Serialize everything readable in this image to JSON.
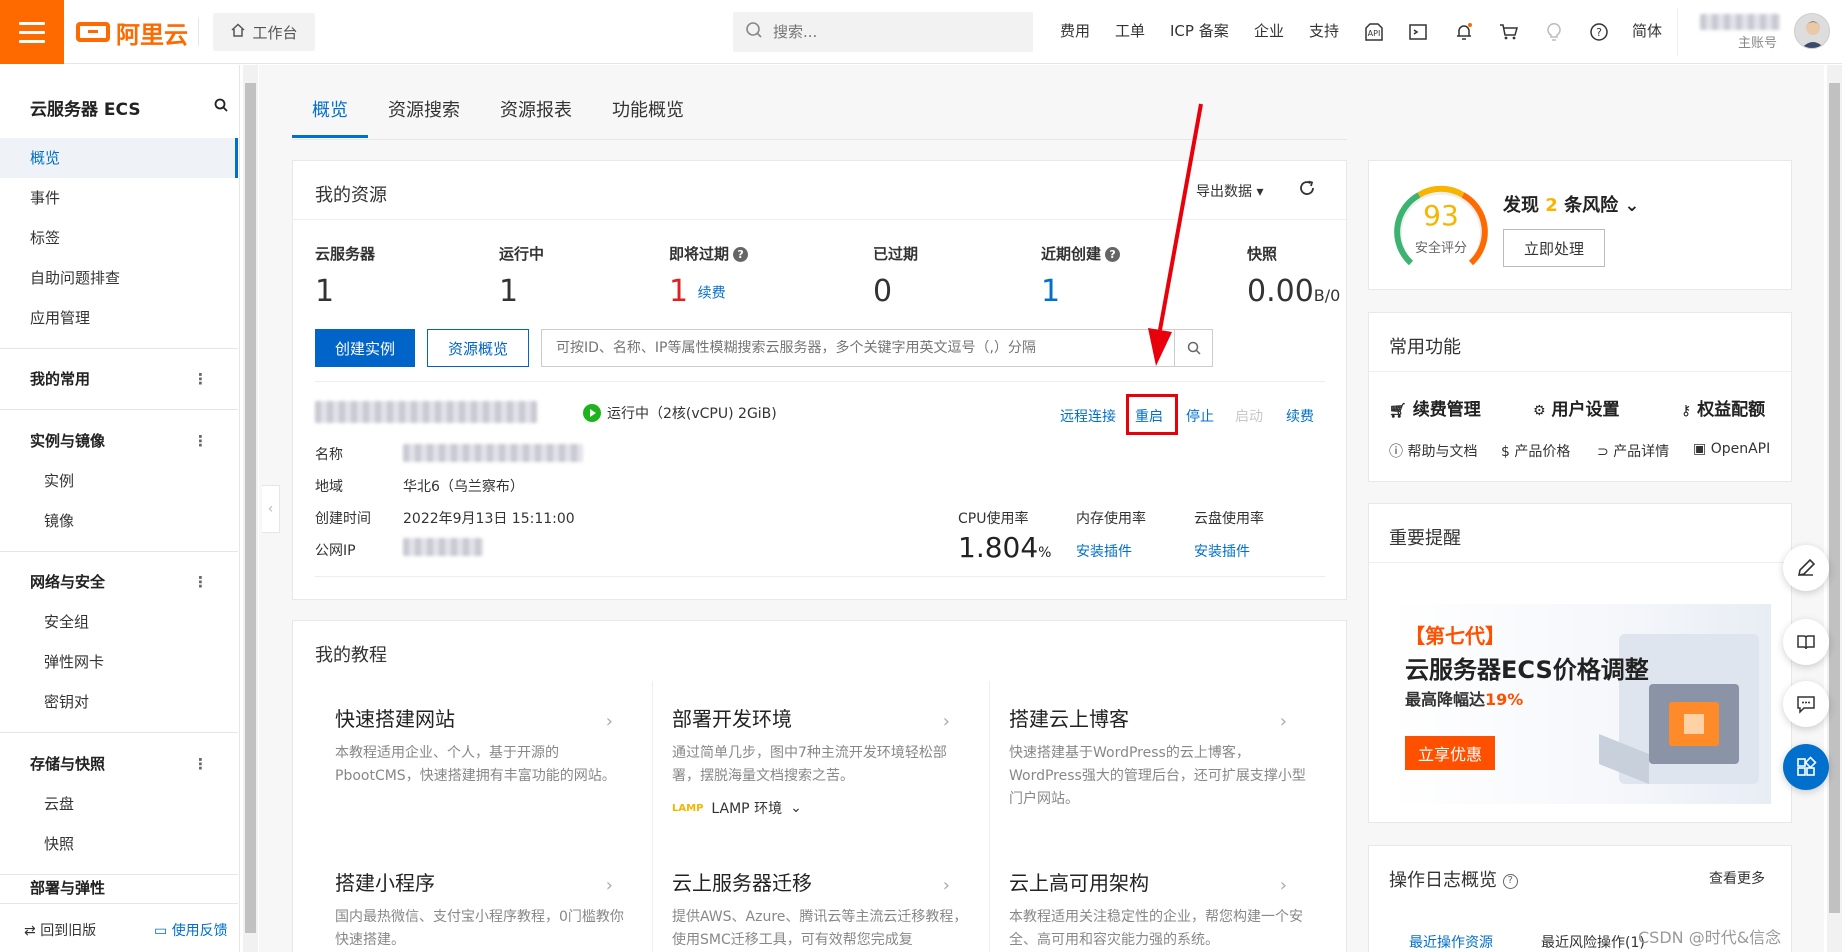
{
  "header": {
    "logo_text": "阿里云",
    "workbench_label": "工作台",
    "search_placeholder": "搜索...",
    "nav": [
      "费用",
      "工单",
      "ICP 备案",
      "企业",
      "支持"
    ],
    "lang_label": "简体",
    "account_sub": "主账号"
  },
  "sidebar": {
    "title": "云服务器 ECS",
    "items": [
      {
        "label": "概览"
      },
      {
        "label": "事件"
      },
      {
        "label": "标签"
      },
      {
        "label": "自助问题排查"
      },
      {
        "label": "应用管理"
      }
    ],
    "favorites": "我的常用",
    "groups": [
      {
        "label": "实例与镜像",
        "children": [
          "实例",
          "镜像"
        ]
      },
      {
        "label": "网络与安全",
        "children": [
          "安全组",
          "弹性网卡",
          "密钥对"
        ]
      },
      {
        "label": "存储与快照",
        "children": [
          "云盘",
          "快照"
        ]
      },
      {
        "label": "部署与弹性"
      }
    ],
    "footer_back": "回到旧版",
    "footer_feedback": "使用反馈"
  },
  "tabs": [
    "概览",
    "资源搜索",
    "资源报表",
    "功能概览"
  ],
  "resources": {
    "title": "我的资源",
    "export_label": "导出数据",
    "stats": [
      {
        "label": "云服务器",
        "value": "1"
      },
      {
        "label": "运行中",
        "value": "1"
      },
      {
        "label": "即将过期",
        "value": "1",
        "action": "续费"
      },
      {
        "label": "已过期",
        "value": "0"
      },
      {
        "label": "近期创建",
        "value": "1"
      },
      {
        "label": "快照",
        "value": "0.00",
        "unit": "B/0"
      }
    ],
    "create_button": "创建实例",
    "overview_button": "资源概览",
    "search_placeholder": "可按ID、名称、IP等属性模糊搜索云服务器，多个关键字用英文逗号（,）分隔",
    "instance": {
      "status": "运行中（2核(vCPU) 2GiB)",
      "actions": [
        "远程连接",
        "重启",
        "停止",
        "启动",
        "续费"
      ],
      "fields": [
        {
          "label": "名称",
          "value": ""
        },
        {
          "label": "地域",
          "value": "华北6（乌兰察布）"
        },
        {
          "label": "创建时间",
          "value": "2022年9月13日 15:11:00"
        },
        {
          "label": "公网IP",
          "value": ""
        }
      ],
      "metrics": [
        {
          "label": "CPU使用率",
          "value": "1.804",
          "unit": "%"
        },
        {
          "label": "内存使用率",
          "link": "安装插件"
        },
        {
          "label": "云盘使用率",
          "link": "安装插件"
        }
      ]
    }
  },
  "tutorials": {
    "title": "我的教程",
    "items": [
      {
        "title": "快速搭建网站",
        "desc": "本教程适用企业、个人，基于开源的PbootCMS，快速搭建拥有丰富功能的网站。"
      },
      {
        "title": "部署开发环境",
        "desc": "通过简单几步，图中7种主流开发环境轻松部署，摆脱海量文档搜索之苦。",
        "extra": "LAMP 环境"
      },
      {
        "title": "搭建云上博客",
        "desc": "快速搭建基于WordPress的云上博客，WordPress强大的管理后台，还可扩展支撑小型门户网站。"
      },
      {
        "title": "搭建小程序",
        "desc": "国内最热微信、支付宝小程序教程，0门槛教你快速搭建。"
      },
      {
        "title": "云上服务器迁移",
        "desc": "提供AWS、Azure、腾讯云等主流云迁移教程，使用SMC迁移工具，可有效帮您完成复"
      },
      {
        "title": "云上高可用架构",
        "desc": "本教程适用关注稳定性的企业，帮您构建一个安全、高可用和容灾能力强的系统。"
      }
    ]
  },
  "security": {
    "score": "93",
    "score_label": "安全评分",
    "risk_prefix": "发现",
    "risk_count": "2",
    "risk_suffix": "条风险",
    "action": "立即处理"
  },
  "common": {
    "title": "常用功能",
    "primary": [
      "续费管理",
      "用户设置",
      "权益配额"
    ],
    "secondary": [
      "帮助与文档",
      "产品价格",
      "产品详情",
      "OpenAPI"
    ]
  },
  "reminder": {
    "title": "重要提醒",
    "banner_tag": "【第七代】",
    "banner_title": "云服务器ECS价格调整",
    "banner_sub_prefix": "最高降幅达",
    "banner_sub_value": "19%",
    "banner_button": "立享优惠"
  },
  "oplog": {
    "title": "操作日志概览",
    "more": "查看更多",
    "tabs": [
      "最近操作资源",
      "最近风险操作(1)"
    ]
  },
  "watermark": "CSDN @时代&信念",
  "colors": {
    "brand": "#ff6a00",
    "primary": "#0070cc",
    "danger": "#e02020",
    "highlight": "#e8000b",
    "score_yellow": "#f7b500"
  }
}
